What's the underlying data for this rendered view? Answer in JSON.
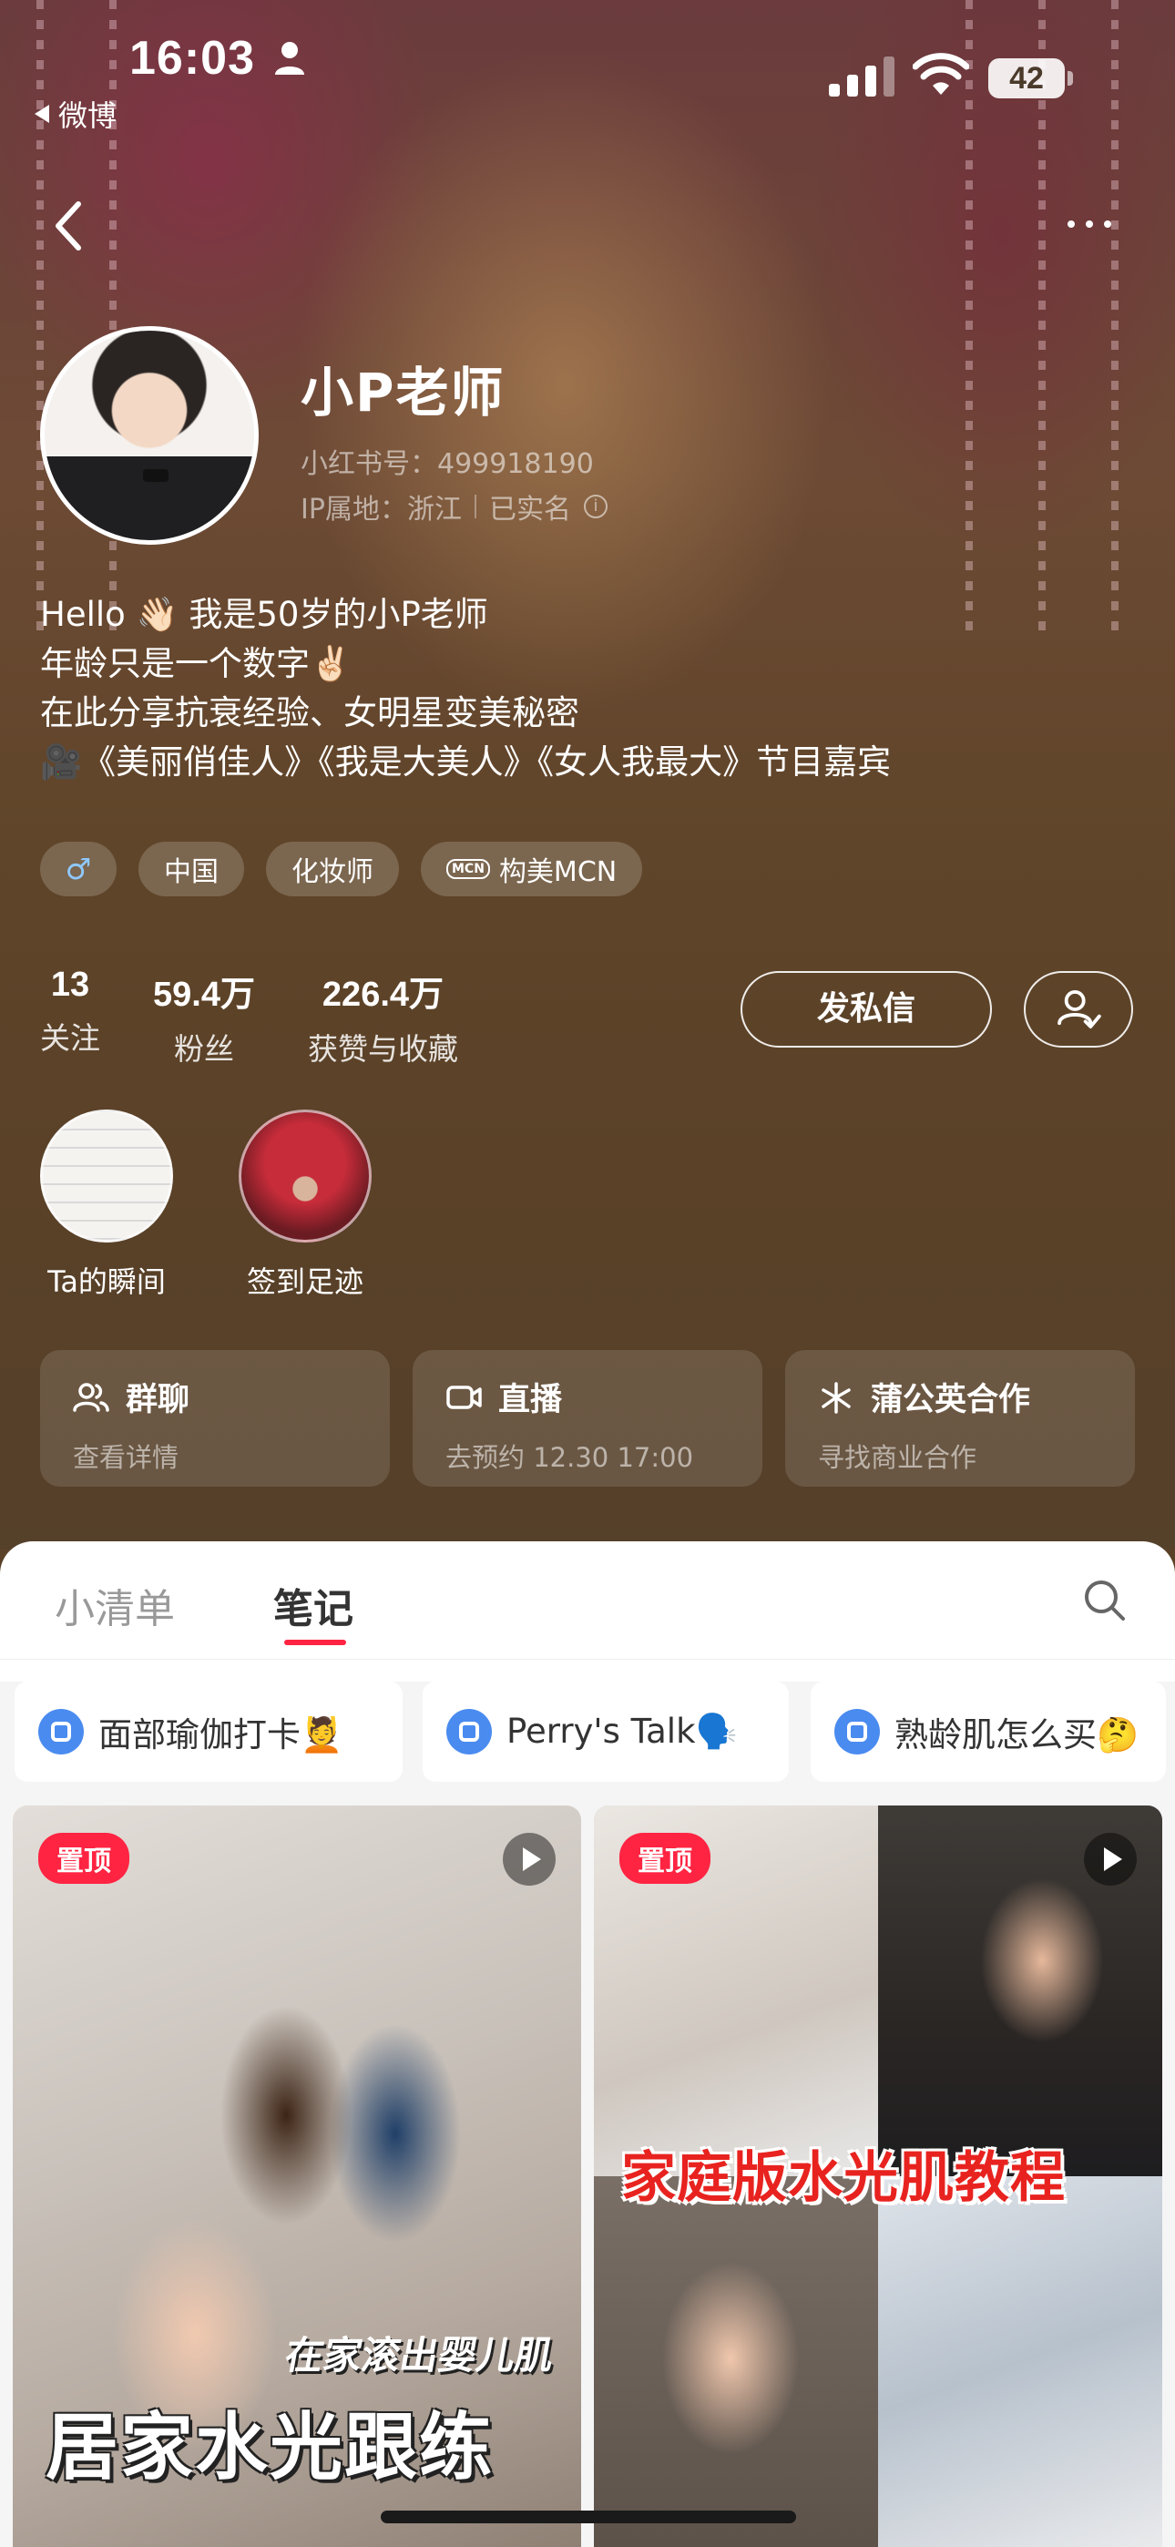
{
  "status_bar": {
    "time": "16:03",
    "back_app": "微博",
    "battery": "42"
  },
  "profile": {
    "name": "小P老师",
    "redbook_id": "小红书号：499918190",
    "ip_location": "IP属地：浙江",
    "verified": "已实名",
    "bio": [
      "Hello 👋🏻 我是50岁的小P老师",
      "年龄只是一个数字✌🏻",
      "在此分享抗衰经验、女明星变美秘密",
      "🎥《美丽俏佳人》《我是大美人》《女人我最大》节目嘉宾"
    ],
    "tags": {
      "gender": "♂",
      "country": "中国",
      "job": "化妆师",
      "mcn": "构美MCN",
      "mcn_badge": "MCN"
    }
  },
  "stats": [
    {
      "value": "13",
      "label": "关注"
    },
    {
      "value": "59.4万",
      "label": "粉丝"
    },
    {
      "value": "226.4万",
      "label": "获赞与收藏"
    }
  ],
  "actions": {
    "message": "发私信"
  },
  "highlights": [
    {
      "label": "Ta的瞬间"
    },
    {
      "label": "签到足迹"
    }
  ],
  "features": [
    {
      "title": "群聊",
      "sub": "查看详情",
      "icon": "group-icon"
    },
    {
      "title": "直播",
      "sub": "去预约 12.30 17:00",
      "icon": "live-icon"
    },
    {
      "title": "蒲公英合作",
      "sub": "寻找商业合作",
      "icon": "dandelion-icon"
    }
  ],
  "tabs": {
    "list": "小清单",
    "notes": "笔记"
  },
  "collections": [
    "面部瑜伽打卡💆",
    "Perry's Talk🗣️",
    "熟龄肌怎么买🤔"
  ],
  "notes": [
    {
      "pin": "置顶",
      "caption_small": "在家滚出婴儿肌",
      "caption_big": "居家水光跟练"
    },
    {
      "pin": "置顶",
      "caption_mid": "家庭版水光肌教程"
    }
  ]
}
